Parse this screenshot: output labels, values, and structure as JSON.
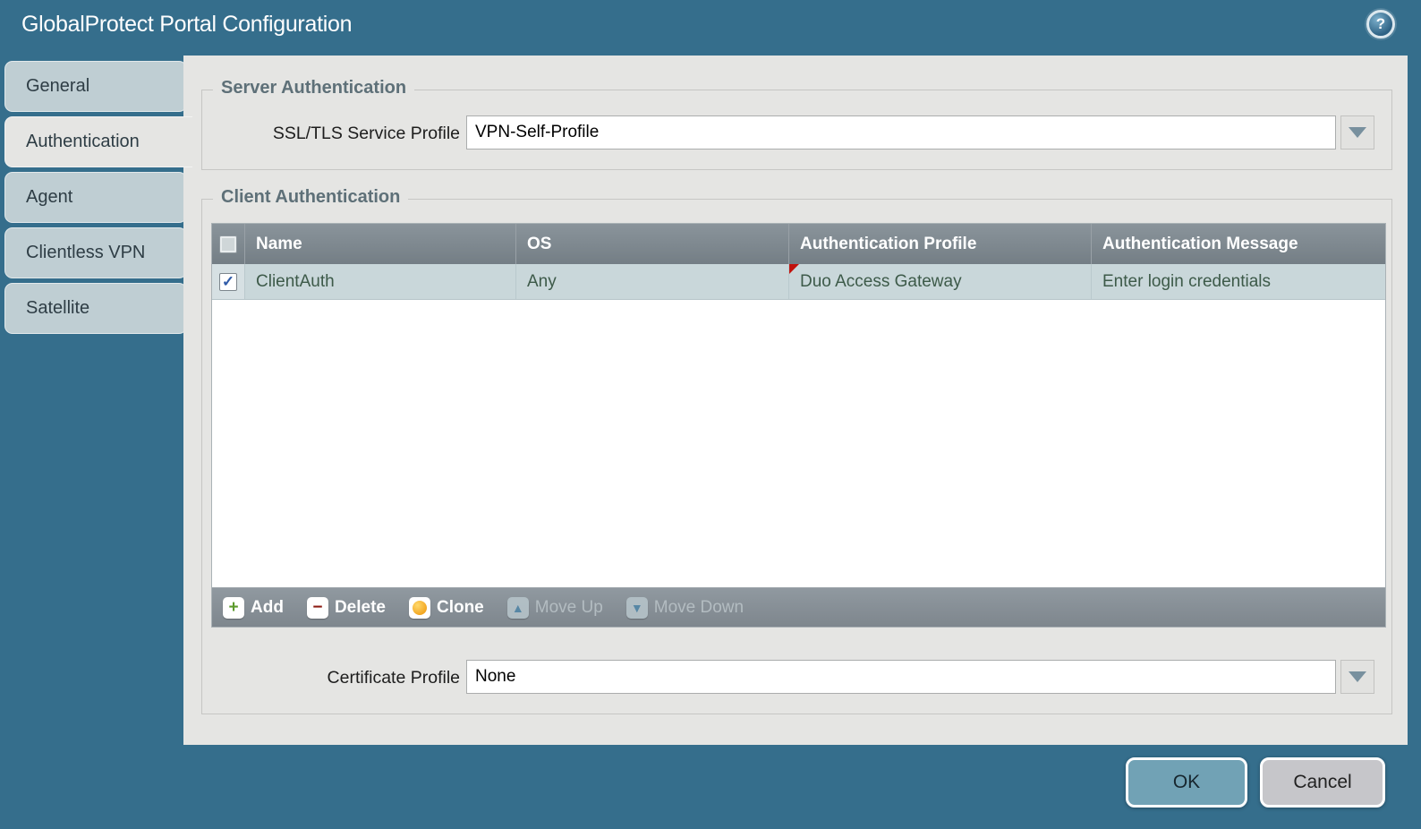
{
  "window": {
    "title": "GlobalProtect Portal Configuration",
    "help_label": "?"
  },
  "sidebar": {
    "active_tab": "Authentication",
    "tabs": [
      {
        "label": "General"
      },
      {
        "label": "Authentication"
      },
      {
        "label": "Agent"
      },
      {
        "label": "Clientless VPN"
      },
      {
        "label": "Satellite"
      }
    ]
  },
  "server_auth": {
    "legend": "Server Authentication",
    "ssl_profile_label": "SSL/TLS Service Profile",
    "ssl_profile_value": "VPN-Self-Profile"
  },
  "client_auth": {
    "legend": "Client Authentication",
    "table": {
      "columns": [
        "Name",
        "OS",
        "Authentication Profile",
        "Authentication Message"
      ],
      "rows": [
        {
          "checked": true,
          "check_glyph": "✓",
          "name": "ClientAuth",
          "os": "Any",
          "auth_profile": "Duo Access Gateway",
          "auth_message": "Enter login credentials",
          "modified_flag": true
        }
      ]
    },
    "toolbar": {
      "buttons": [
        {
          "label": "Add",
          "glyph": "+",
          "enabled": true
        },
        {
          "label": "Delete",
          "glyph": "−",
          "enabled": true
        },
        {
          "label": "Clone",
          "glyph": "",
          "enabled": true
        },
        {
          "label": "Move Up",
          "glyph": "▲",
          "enabled": false
        },
        {
          "label": "Move Down",
          "glyph": "▼",
          "enabled": false
        }
      ]
    },
    "certificate_profile_label": "Certificate Profile",
    "certificate_profile_value": "None"
  },
  "footer": {
    "ok_label": "OK",
    "cancel_label": "Cancel"
  },
  "colors": {
    "background": "#356E8C",
    "panel": "#E5E5E3",
    "tab_inactive": "#BFCED3",
    "table_header": "#7D868D",
    "row_selected": "#C9D7DA",
    "row_text": "#3D5A49",
    "toolbar": "#878F95",
    "ok_button": "#71A2B5",
    "cancel_button": "#C6C6CA",
    "modified_flag_red": "#C1120C"
  }
}
